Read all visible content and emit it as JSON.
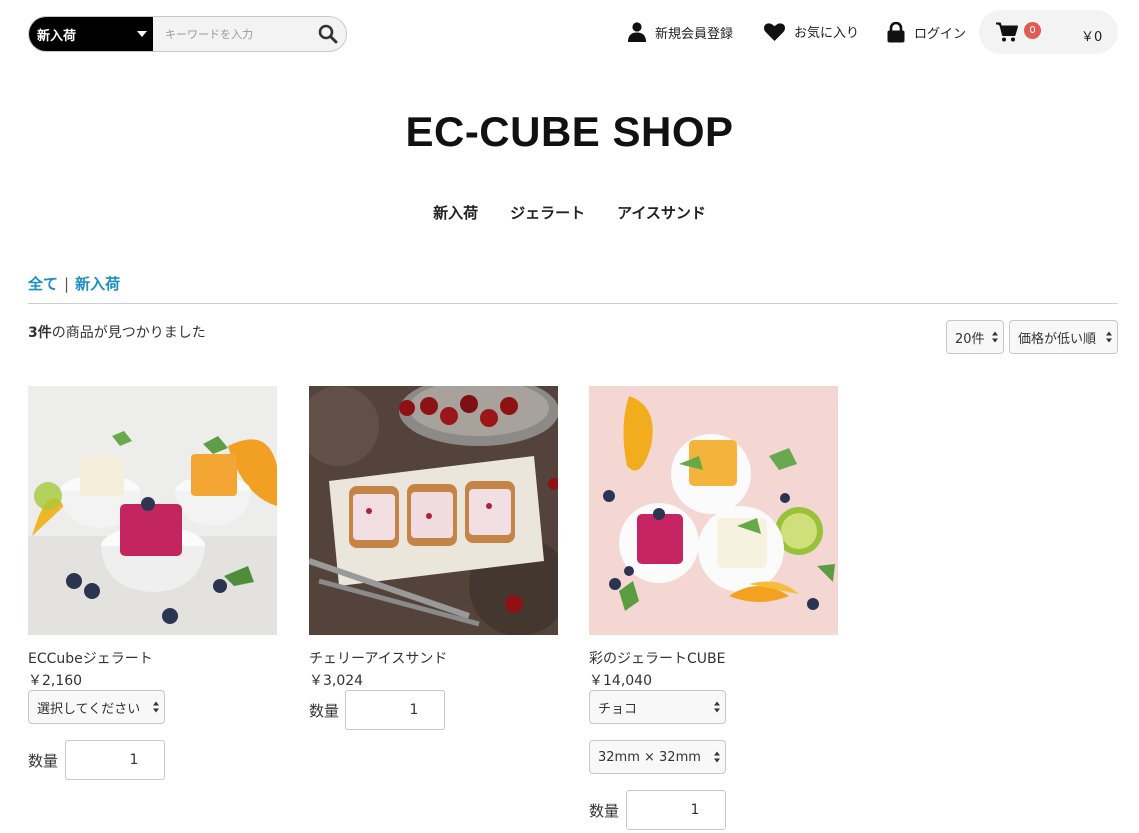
{
  "header": {
    "search": {
      "category": "新入荷",
      "placeholder": "キーワードを入力"
    },
    "nav": {
      "register": "新規会員登録",
      "favorites": "お気に入り",
      "login": "ログイン"
    },
    "cart": {
      "count": "0",
      "total": "￥0"
    }
  },
  "shop_title": "EC-CUBE SHOP",
  "category_nav": [
    "新入荷",
    "ジェラート",
    "アイスサンド"
  ],
  "breadcrumb": {
    "all": "全て",
    "separator": "|",
    "current": "新入荷"
  },
  "results": {
    "count": "3件",
    "text": "の商品が見つかりました"
  },
  "sort": {
    "per_page": "20件",
    "order": "価格が低い順"
  },
  "products": [
    {
      "name": "ECCubeジェラート",
      "price": "￥2,160",
      "select1": "選択してください",
      "qty_label": "数量",
      "qty": "1"
    },
    {
      "name": "チェリーアイスサンド",
      "price": "￥3,024",
      "qty_label": "数量",
      "qty": "1"
    },
    {
      "name": "彩のジェラートCUBE",
      "price": "￥14,040",
      "select1": "チョコ",
      "select2": "32mm × 32mm",
      "qty_label": "数量",
      "qty": "1"
    }
  ],
  "colors": {
    "accent_link": "#1d8ec4",
    "badge": "#de5d50",
    "search_category_bg": "#000000"
  }
}
